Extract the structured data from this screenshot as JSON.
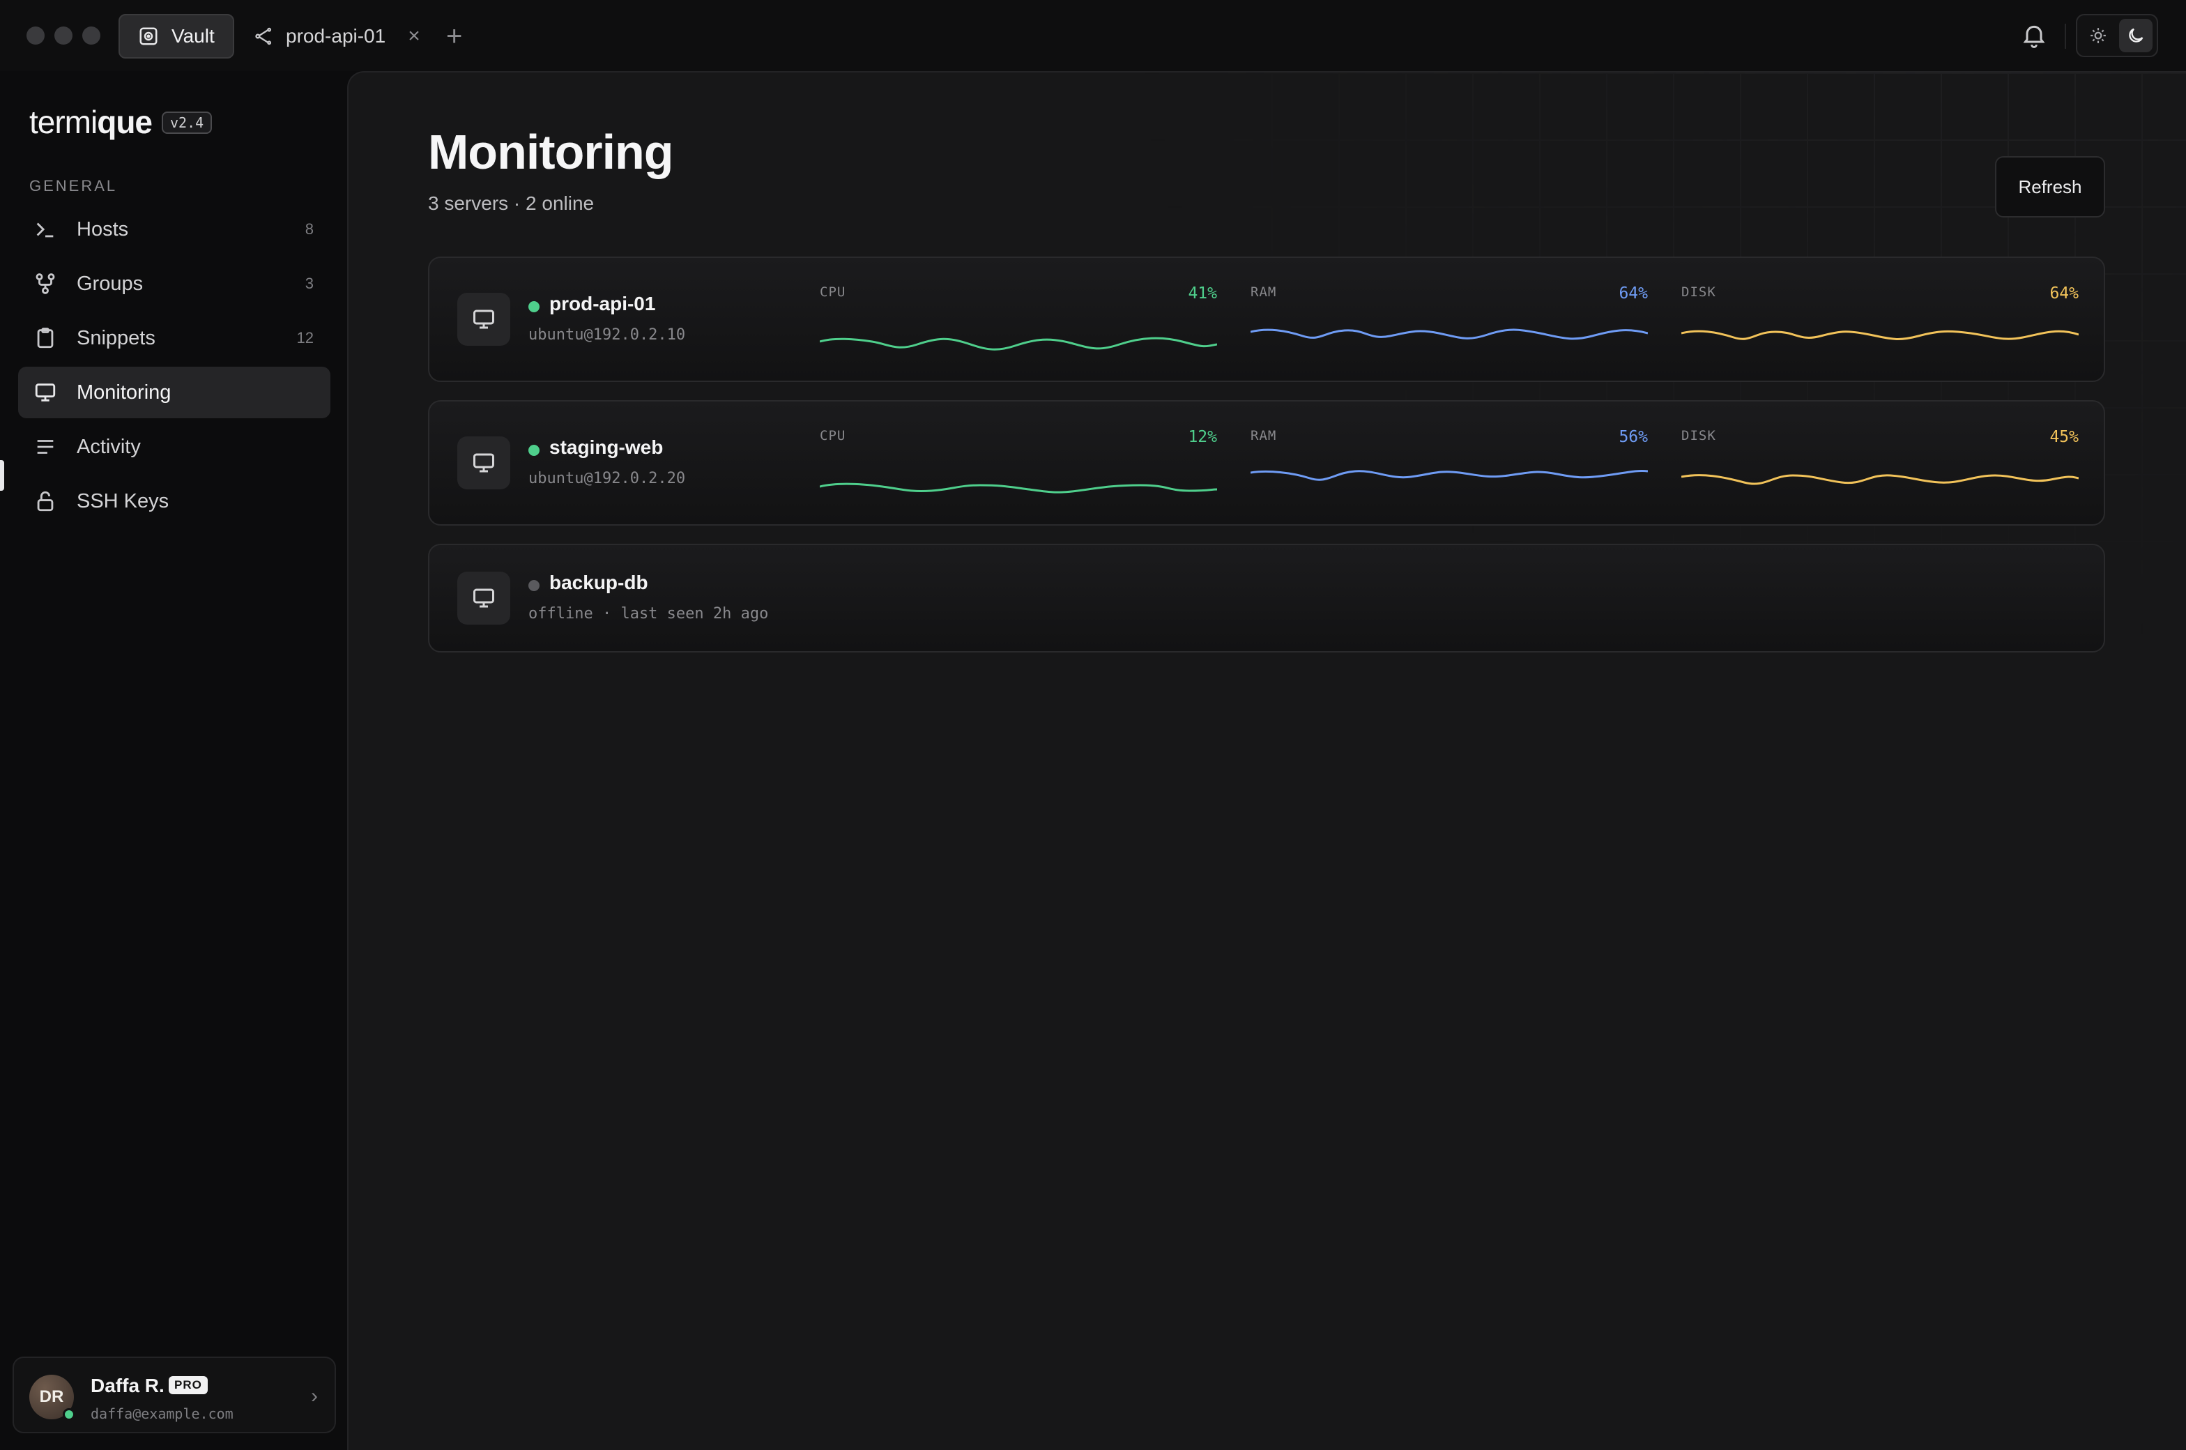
{
  "titlebar": {
    "tabs": [
      {
        "label": "Vault",
        "icon": "vault-icon",
        "active": true
      },
      {
        "label": "prod-api-01",
        "icon": "ssh-icon",
        "active": false
      }
    ],
    "new_tab_symbol": "+",
    "close_symbol": "×"
  },
  "sidebar": {
    "brand_regular": "termi",
    "brand_bold": "que",
    "version": "v2.4",
    "section_label": "GENERAL",
    "items": [
      {
        "label": "Hosts",
        "count": "8",
        "icon": "terminal-icon"
      },
      {
        "label": "Groups",
        "count": "3",
        "icon": "groups-icon"
      },
      {
        "label": "Snippets",
        "count": "12",
        "icon": "clipboard-icon"
      },
      {
        "label": "Monitoring",
        "count": "",
        "icon": "monitor-icon",
        "active": true
      },
      {
        "label": "Activity",
        "count": "",
        "icon": "list-icon"
      },
      {
        "label": "SSH Keys",
        "count": "",
        "icon": "lock-icon"
      }
    ],
    "user": {
      "initials": "DR",
      "name": "Daffa R.",
      "plan": "PRO",
      "email": "daffa@example.com"
    }
  },
  "main": {
    "title": "Monitoring",
    "subtitle": "3 servers · 2 online",
    "refresh_label": "Refresh",
    "servers": [
      {
        "name": "prod-api-01",
        "host": "ubuntu@192.0.2.10",
        "status": "online",
        "metrics": [
          {
            "label": "CPU",
            "value": "41%",
            "color": "#4fcf8c"
          },
          {
            "label": "RAM",
            "value": "64%",
            "color": "#6f9cf5"
          },
          {
            "label": "DISK",
            "value": "64%",
            "color": "#f2c35a"
          }
        ]
      },
      {
        "name": "staging-web",
        "host": "ubuntu@192.0.2.20",
        "status": "online",
        "metrics": [
          {
            "label": "CPU",
            "value": "12%",
            "color": "#4fcf8c"
          },
          {
            "label": "RAM",
            "value": "56%",
            "color": "#6f9cf5"
          },
          {
            "label": "DISK",
            "value": "45%",
            "color": "#f2c35a"
          }
        ]
      },
      {
        "name": "backup-db",
        "host": "offline · last seen 2h ago",
        "status": "offline",
        "metrics": []
      }
    ]
  },
  "colors": {
    "online": "#4fcf8c",
    "offline": "#5a5a5e",
    "cpu": "#4fcf8c",
    "ram": "#6f9cf5",
    "disk": "#f2c35a"
  }
}
